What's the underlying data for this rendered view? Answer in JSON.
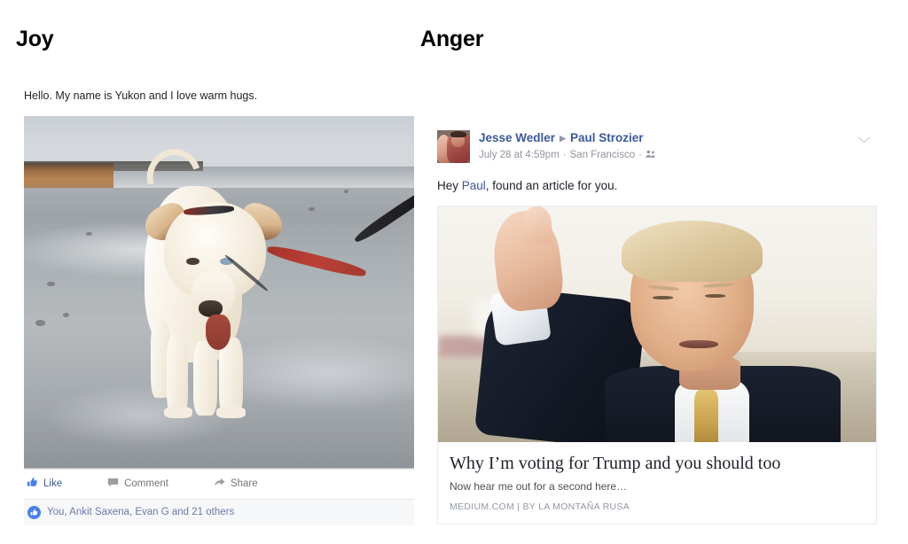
{
  "columns": {
    "joy_heading": "Joy",
    "anger_heading": "Anger"
  },
  "joy_post": {
    "caption": "Hello. My name is Yukon and I love warm hugs.",
    "photo_alt": "white dog on wet beach with red leash",
    "actions": [
      {
        "label": "Like",
        "icon": "thumbs-up-icon",
        "liked": true
      },
      {
        "label": "Comment",
        "icon": "comment-bubble-icon",
        "liked": false
      },
      {
        "label": "Share",
        "icon": "share-arrow-icon",
        "liked": false
      }
    ],
    "like_badge_icon": "thumbs-up-badge-icon",
    "likes_text": "You, Ankit Saxena, Evan G and 21 others"
  },
  "anger_post": {
    "author": "Jesse Wedler",
    "separator_icon": "triangle-right-icon",
    "recipient": "Paul Strozier",
    "timestamp": "July 28 at 4:59pm",
    "meta_dot": "·",
    "location": "San Francisco",
    "audience_icon": "friends-icon",
    "menu_icon": "chevron-down-icon",
    "avatar_alt": "profile photo",
    "message_prefix": "Hey ",
    "message_mention": "Paul",
    "message_suffix": ", found an article for you.",
    "link_card": {
      "image_alt": "man in dark suit giving thumbs up",
      "title": "Why I’m voting for Trump and you should too",
      "description": "Now hear me out for a second here…",
      "source": "MEDIUM.COM  |  BY LA MONTAÑA RUSA"
    }
  },
  "colors": {
    "facebook_blue": "#3b5998",
    "link_blue": "#6b7ba8",
    "like_badge_blue": "#4a80e4",
    "muted_gray": "#90949c",
    "bar_bg": "#f6f7f9",
    "border": "#e9ebee"
  }
}
